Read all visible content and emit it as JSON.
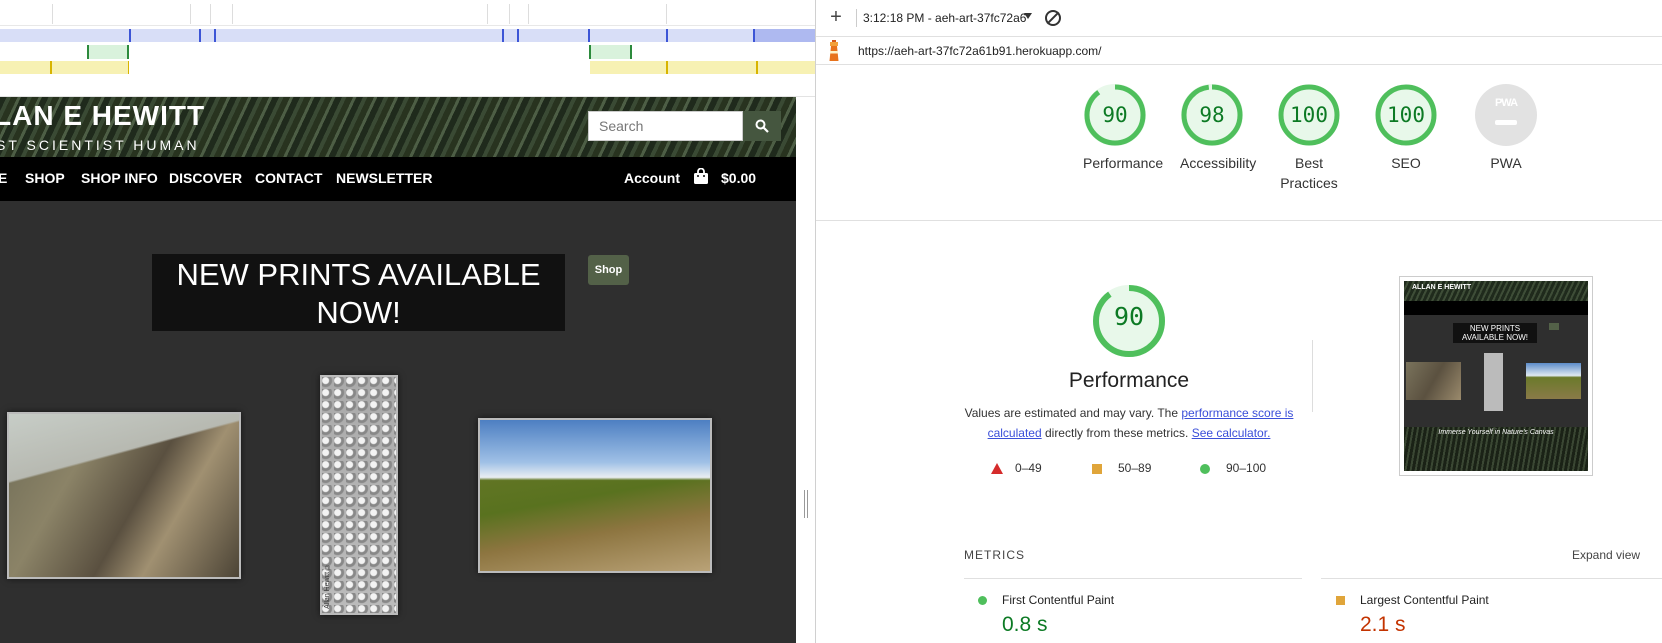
{
  "site": {
    "brand_name": "LAN E HEWITT",
    "brand_tagline": "ST  SCIENTIST  HUMAN",
    "search_placeholder": "Search",
    "nav": [
      "E",
      "SHOP",
      "SHOP INFO",
      "DISCOVER",
      "CONTACT",
      "NEWSLETTER"
    ],
    "account_label": "Account",
    "cart_total": "$0.00",
    "promo_heading": "NEW PRINTS AVAILABLE NOW!",
    "shop_button": "Shop",
    "artwork_signature": "Allan Hewitt ©"
  },
  "lighthouse": {
    "report_time": "3:12:18 PM - aeh-art-37fc72a6",
    "url": "https://aeh-art-37fc72a61b91.herokuapp.com/",
    "scores": [
      {
        "label": "Performance",
        "value": "90"
      },
      {
        "label": "Accessibility",
        "value": "98"
      },
      {
        "label": "Best Practices",
        "value": "100"
      },
      {
        "label": "SEO",
        "value": "100"
      },
      {
        "label": "PWA",
        "value": ""
      }
    ],
    "pwa_badge": "PWA",
    "score_color": "#0c7a24",
    "performance": {
      "score": "90",
      "title": "Performance",
      "desc_pre": "Values are estimated and may vary. The ",
      "desc_link1": "performance score is calculated",
      "desc_mid": " directly from these metrics. ",
      "desc_link2": "See calculator."
    },
    "legend": [
      {
        "range": "0–49",
        "color": "#d52b2b"
      },
      {
        "range": "50–89",
        "color": "#e0a53a"
      },
      {
        "range": "90–100",
        "color": "#4fbf5c"
      }
    ],
    "thumbnail": {
      "brand": "ALLAN E HEWITT",
      "promo": "NEW PRINTS AVAILABLE NOW!",
      "caption": "Immerse Yourself in Nature's Canvas"
    },
    "metrics_heading": "METRICS",
    "expand_view": "Expand view",
    "metrics": [
      {
        "label": "First Contentful Paint",
        "value": "0.8 s",
        "color": "#0c7a24"
      },
      {
        "label": "Largest Contentful Paint",
        "value": "2.1 s",
        "color": "#c33300"
      }
    ]
  }
}
